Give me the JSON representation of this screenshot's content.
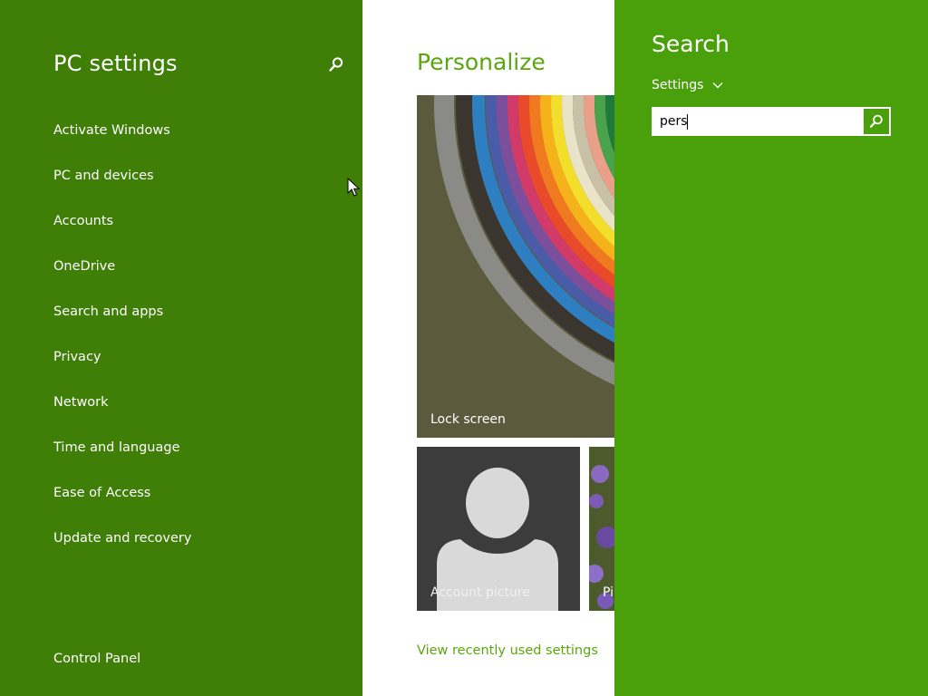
{
  "nav": {
    "title": "PC settings",
    "items": [
      "Activate Windows",
      "PC and devices",
      "Accounts",
      "OneDrive",
      "Search and apps",
      "Privacy",
      "Network",
      "Time and language",
      "Ease of Access",
      "Update and recovery"
    ],
    "control_panel": "Control Panel",
    "bg_color": "#3f7f07"
  },
  "content": {
    "title": "Personalize",
    "tiles": {
      "lock_screen": "Lock screen",
      "account_picture": "Account picture",
      "pictures_partial": "Pi"
    },
    "view_recent": "View recently used settings",
    "accent_color": "#5ba60f"
  },
  "search": {
    "title": "Search",
    "scope": "Settings",
    "query": "pers",
    "bg_color": "#4aa00b"
  }
}
